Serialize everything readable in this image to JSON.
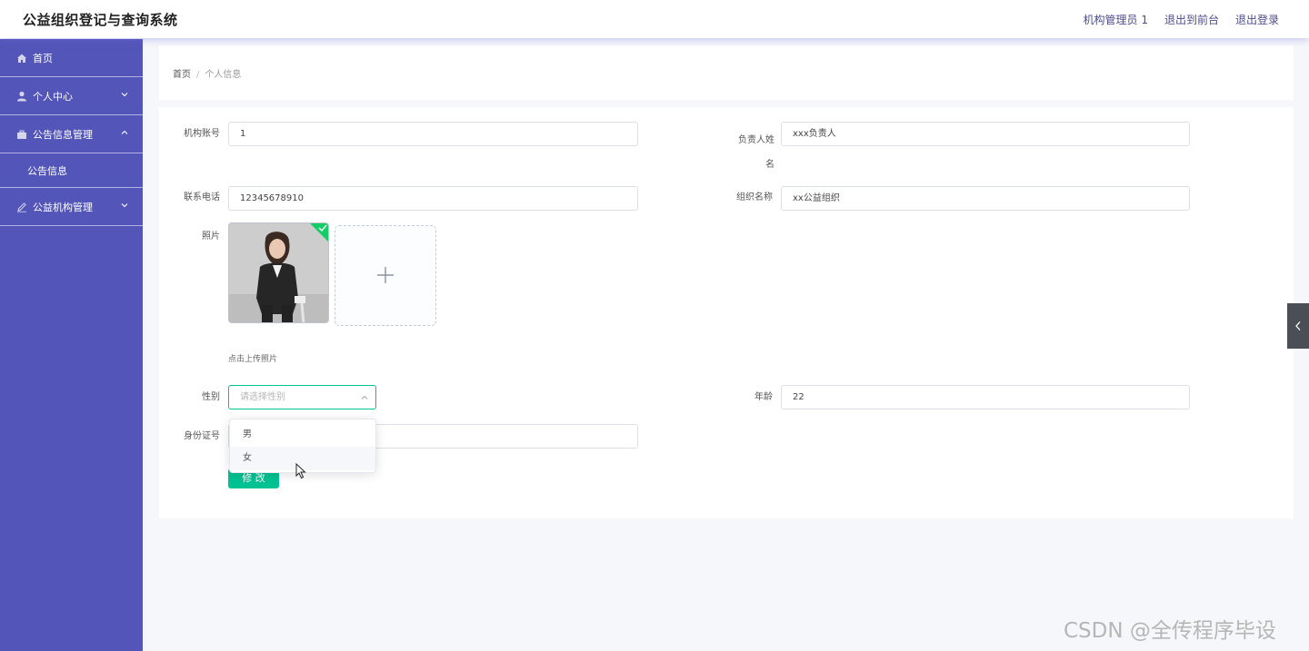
{
  "header": {
    "title": "公益组织登记与查询系统",
    "links": [
      "机构管理员 1",
      "退出到前台",
      "退出登录"
    ]
  },
  "sidebar": {
    "items": [
      {
        "label": "首页",
        "icon": "home-icon"
      },
      {
        "label": "个人中心",
        "icon": "user-icon",
        "chevron": "down"
      },
      {
        "label": "公告信息管理",
        "icon": "briefcase-icon",
        "chevron": "up"
      },
      {
        "label": "公告信息",
        "sub": true
      },
      {
        "label": "公益机构管理",
        "icon": "edit-icon",
        "chevron": "down"
      }
    ]
  },
  "breadcrumb": {
    "home": "首页",
    "separator": "/",
    "current": "个人信息"
  },
  "form": {
    "account_label": "机构账号",
    "account_value": "1",
    "manager_label": "负责人姓名",
    "manager_value": "xxx负责人",
    "phone_label": "联系电话",
    "phone_value": "12345678910",
    "org_label": "组织名称",
    "org_value": "xx公益组织",
    "photo_label": "照片",
    "upload_tip": "点击上传照片",
    "gender_label": "性别",
    "gender_placeholder": "请选择性别",
    "age_label": "年龄",
    "age_value": "22",
    "id_label": "身份证号",
    "id_value": "",
    "submit_label": "修 改"
  },
  "gender_options": [
    "男",
    "女"
  ],
  "watermark": "CSDN @全传程序毕设",
  "colors": {
    "sidebar": "#5355b8",
    "accent": "#00c292",
    "page_bg": "#f5f7fa"
  }
}
